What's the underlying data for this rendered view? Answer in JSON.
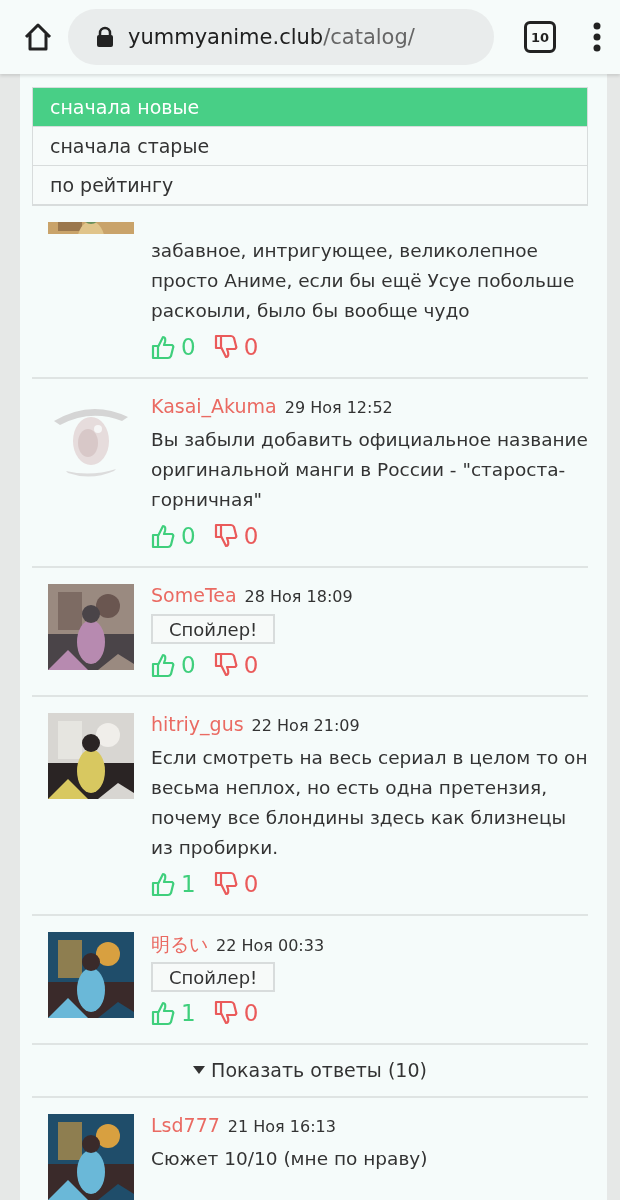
{
  "browser": {
    "url_host": "yummyanime.club",
    "url_path": "/catalog/",
    "tab_count": "10"
  },
  "sort_menu": {
    "options": [
      {
        "label": "сначала новые",
        "selected": true
      },
      {
        "label": "сначала старые",
        "selected": false
      },
      {
        "label": "по рейтингу",
        "selected": false
      }
    ]
  },
  "comments": [
    {
      "text": "забавное, интригующее, великолепное просто Аниме, если бы ещё Усуе побольше раскоыли, было бы вообще чудо",
      "likes": "0",
      "dislikes": "0"
    },
    {
      "author": "Kasai_Akuma",
      "date": "29 Ноя 12:52",
      "avatar": {
        "kind": "placeholder"
      },
      "text": "Вы забыли добавить официальное название оригинальной манги в России - \"староста-горничная\"",
      "likes": "0",
      "dislikes": "0"
    },
    {
      "author": "SomeTea",
      "date": "28 Ноя 18:09",
      "spoiler": "Спойлер!",
      "likes": "0",
      "dislikes": "0"
    },
    {
      "author": "hitriy_gus",
      "date": "22 Ноя 21:09",
      "text": "Если смотреть на весь сериал в целом то он весьма неплох, но есть одна претензия, почему все блондины здесь как близнецы из пробирки.",
      "likes": "1",
      "dislikes": "0"
    },
    {
      "author": "明るい",
      "date": "22 Ноя 00:33",
      "spoiler": "Спойлер!",
      "likes": "1",
      "dislikes": "0"
    }
  ],
  "show_replies": "Показать ответы (10)",
  "next_comment": {
    "author": "Lsd777",
    "date": "21 Ноя 16:13",
    "text": "Сюжет 10/10 (мне по нраву)"
  }
}
